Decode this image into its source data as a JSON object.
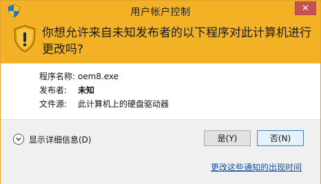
{
  "window": {
    "title": "用户帐户控制",
    "close_glyph": "✕"
  },
  "banner": {
    "question": "你想允许来自未知发布者的以下程序对此计算机进行更改吗?",
    "icon": "uac-shield-warning-icon"
  },
  "info": {
    "program": {
      "label": "程序名称:",
      "value": "oem8.exe"
    },
    "publisher": {
      "label": "发布者:",
      "value": "未知"
    },
    "source": {
      "label": "文件源:",
      "value": "此计算机上的硬盘驱动器"
    }
  },
  "footer": {
    "details_label": "显示详细信息(D)",
    "yes_label": "是(Y)",
    "no_label": "否(N)",
    "change_link": "更改这些通知的出现时间"
  },
  "colors": {
    "banner": "#f3b226",
    "link": "#0f4fa8",
    "close": "#c75050"
  }
}
